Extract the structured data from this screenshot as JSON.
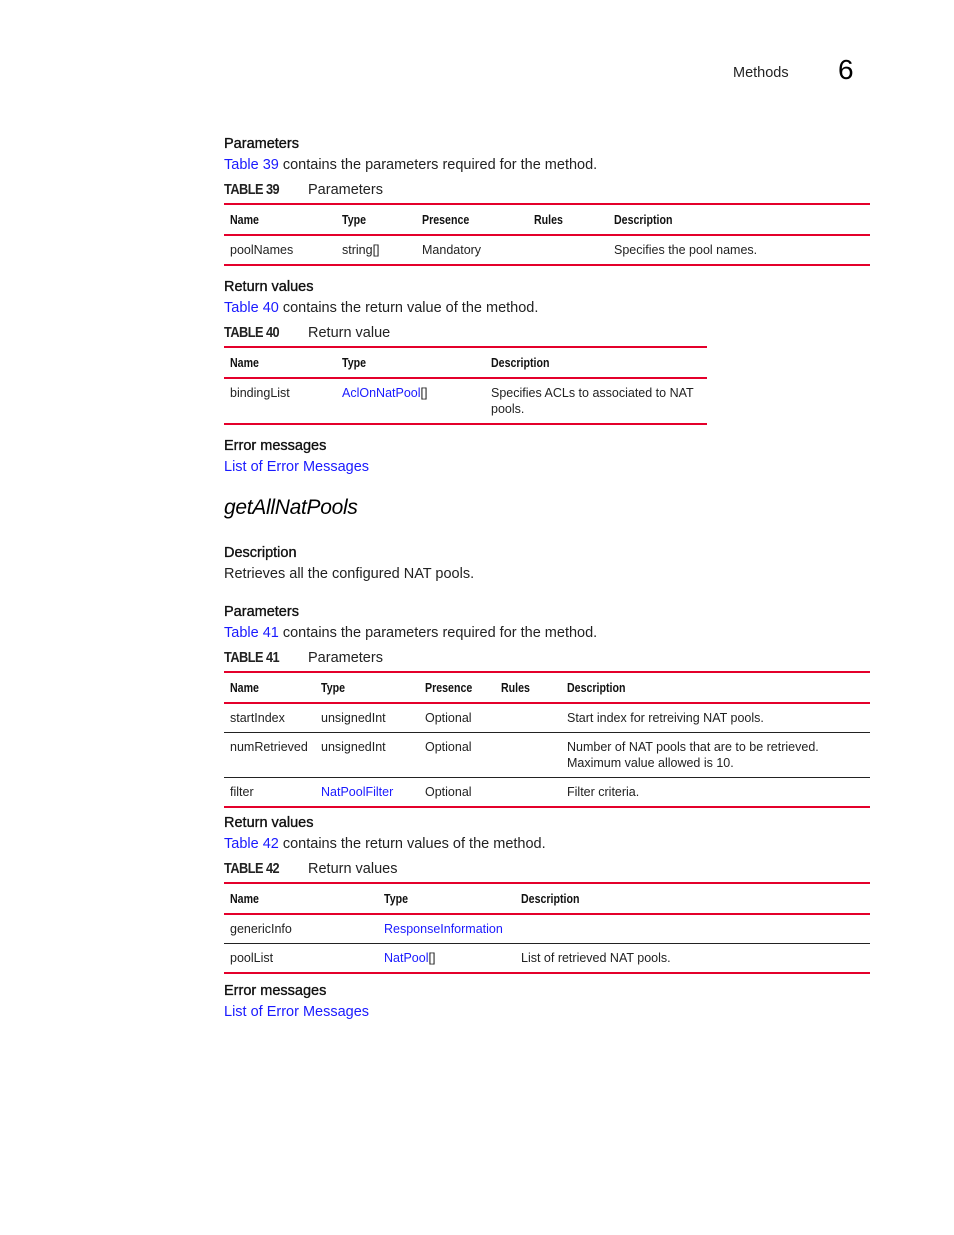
{
  "header": {
    "section": "Methods",
    "chapter": "6"
  },
  "block1": {
    "params_heading": "Parameters",
    "params_link": "Table 39",
    "params_text": " contains the parameters required for the method.",
    "table39": {
      "label": "TABLE 39",
      "title": "Parameters",
      "columns": [
        "Name",
        "Type",
        "Presence",
        "Rules",
        "Description"
      ],
      "rows": [
        {
          "name": "poolNames",
          "type": "string[]",
          "type_link": "",
          "presence": "Mandatory",
          "rules": "",
          "description": "Specifies the pool names."
        }
      ]
    },
    "return_heading": "Return values",
    "return_link": "Table 40",
    "return_text": " contains the return value of the method.",
    "table40": {
      "label": "TABLE 40",
      "title": "Return value",
      "columns": [
        "Name",
        "Type",
        "Description"
      ],
      "rows": [
        {
          "name": "bindingList",
          "type_link": "AclOnNatPool",
          "type_suffix": "[]",
          "description": "Specifies ACLs to associated to NAT pools."
        }
      ]
    },
    "errors_heading": "Error messages",
    "errors_link": "List of Error Messages"
  },
  "method": {
    "title": "getAllNatPools",
    "description_heading": "Description",
    "description_text": "Retrieves all the configured NAT pools.",
    "params_heading": "Parameters",
    "params_link": "Table 41",
    "params_text": " contains the parameters required for the method.",
    "table41": {
      "label": "TABLE 41",
      "title": "Parameters",
      "columns": [
        "Name",
        "Type",
        "Presence",
        "Rules",
        "Description"
      ],
      "rows": [
        {
          "name": "startIndex",
          "type": "unsignedInt",
          "type_link": "",
          "presence": "Optional",
          "rules": "",
          "description": "Start index for retreiving NAT pools."
        },
        {
          "name": "numRetrieved",
          "type": "unsignedInt",
          "type_link": "",
          "presence": "Optional",
          "rules": "",
          "description": "Number of NAT pools that are to be retrieved. Maximum value allowed is 10."
        },
        {
          "name": "filter",
          "type": "",
          "type_link": "NatPoolFilter",
          "presence": "Optional",
          "rules": "",
          "description": "Filter criteria."
        }
      ]
    },
    "return_heading": "Return values",
    "return_link": "Table 42",
    "return_text": " contains the return values of the method.",
    "table42": {
      "label": "TABLE 42",
      "title": "Return values",
      "columns": [
        "Name",
        "Type",
        "Description"
      ],
      "rows": [
        {
          "name": "genericInfo",
          "type_link": "ResponseInformation",
          "type_suffix": "",
          "description": ""
        },
        {
          "name": "poolList",
          "type_link": "NatPool",
          "type_suffix": "[]",
          "description": "List of retrieved NAT pools."
        }
      ]
    },
    "errors_heading": "Error messages",
    "errors_link": "List of Error Messages"
  }
}
